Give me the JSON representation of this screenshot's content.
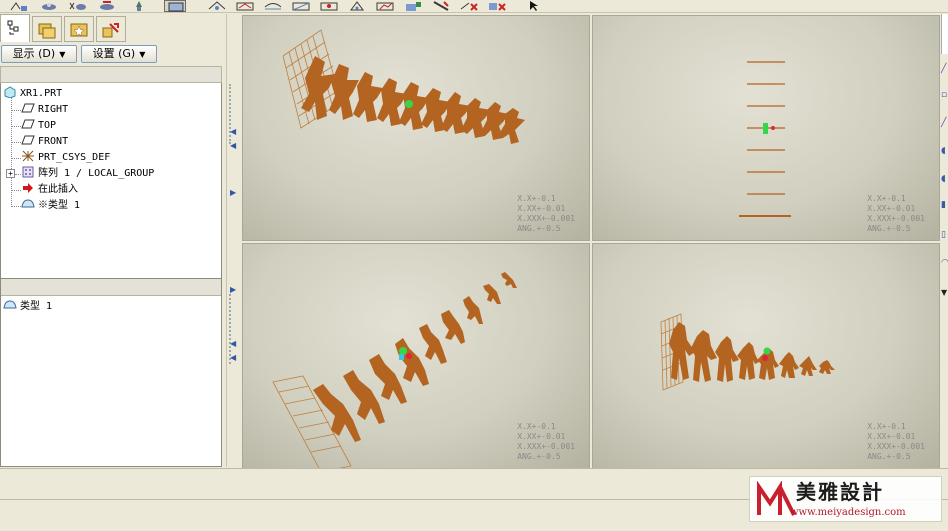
{
  "panel": {
    "show_dropdown": "显示 (D)",
    "settings_dropdown": "设置 (G)"
  },
  "tree": {
    "items": [
      {
        "label": "XR1.PRT",
        "icon": "part-icon"
      },
      {
        "label": "RIGHT",
        "icon": "datum-plane-icon"
      },
      {
        "label": "TOP",
        "icon": "datum-plane-icon"
      },
      {
        "label": "FRONT",
        "icon": "datum-plane-icon"
      },
      {
        "label": "PRT_CSYS_DEF",
        "icon": "csys-icon"
      },
      {
        "label": "阵列 1 / LOCAL_GROUP",
        "icon": "pattern-icon"
      },
      {
        "label": "在此插入",
        "icon": "insert-arrow-icon"
      },
      {
        "label": "※类型 1",
        "icon": "surface-icon"
      }
    ]
  },
  "bottom_list": {
    "items": [
      {
        "label": "类型 1",
        "icon": "surface-icon"
      }
    ]
  },
  "tolerance": [
    "X.X+-0.1",
    "X.XX+-0.01",
    "X.XXX+-0.001",
    "ANG.+-0.5"
  ],
  "watermark": {
    "title": "美雅設計",
    "url": "www.meiyadesign.com"
  },
  "colors": {
    "figure": "#b26420",
    "figure_frame": "#c08040",
    "csys_green": "#36d64a",
    "csys_red": "#e0243a",
    "csys_cyan": "#3ac8d8"
  }
}
